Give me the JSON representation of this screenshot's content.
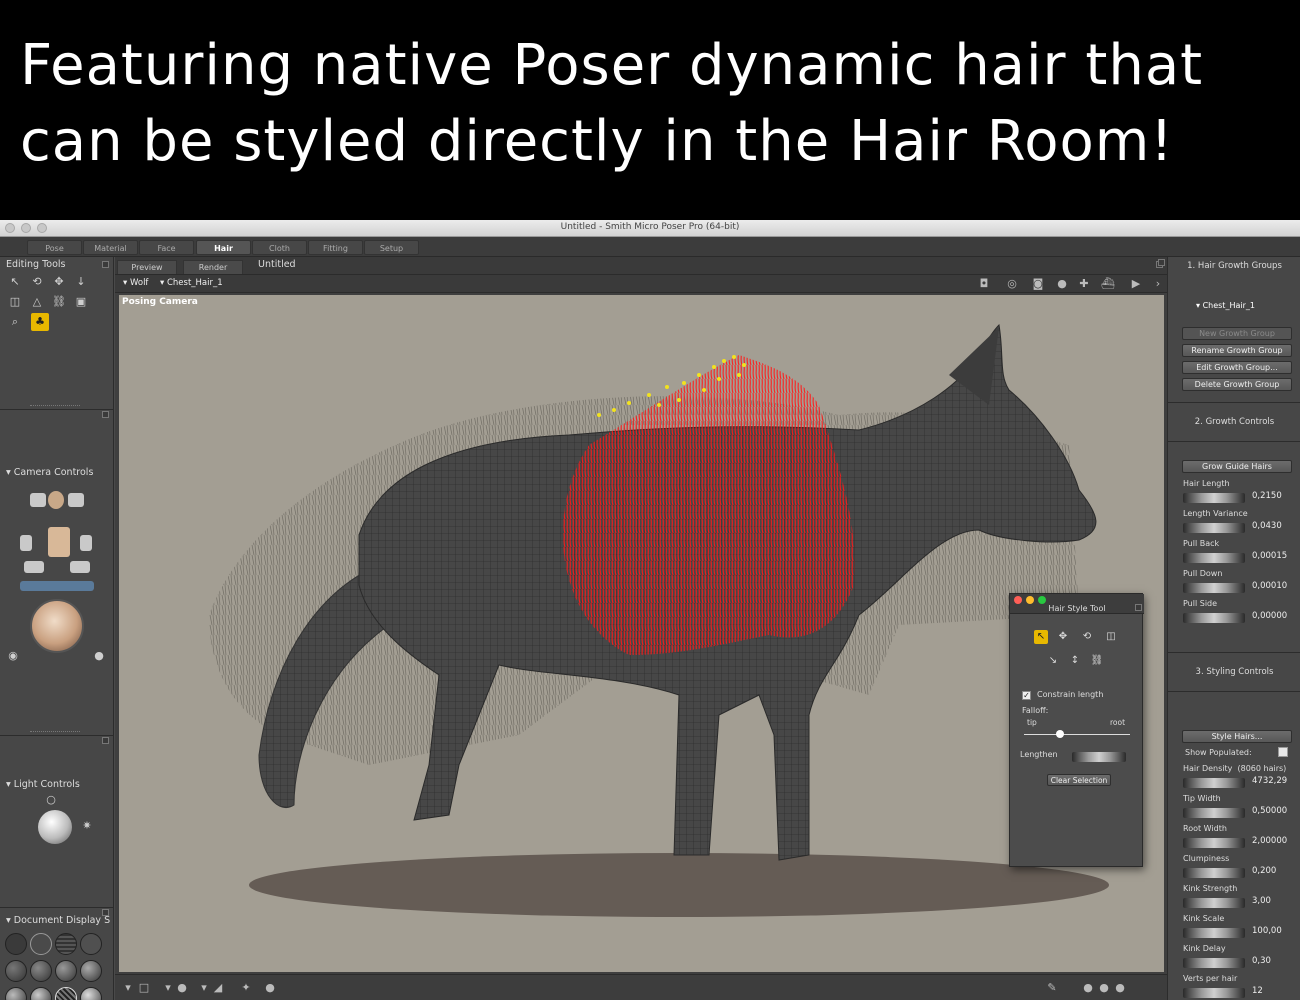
{
  "banner": {
    "line1": "Featuring native Poser dynamic hair that",
    "line2": "can be styled directly in the Hair Room!"
  },
  "window": {
    "title": "Untitled - Smith Micro Poser Pro  (64-bit)"
  },
  "room_tabs": [
    {
      "label": "Pose"
    },
    {
      "label": "Material"
    },
    {
      "label": "Face"
    },
    {
      "label": "Hair"
    },
    {
      "label": "Cloth"
    },
    {
      "label": "Fitting"
    },
    {
      "label": "Setup"
    }
  ],
  "active_room": "Hair",
  "left_panel": {
    "editing_tools": "Editing Tools",
    "camera_controls": "Camera Controls",
    "light_controls": "Light Controls",
    "document_display": "Document Display S"
  },
  "viewport": {
    "tabs": [
      {
        "label": "Preview"
      },
      {
        "label": "Render"
      }
    ],
    "document_name": "Untitled",
    "figure_select": "Wolf",
    "actor_select": "Chest_Hair_1",
    "camera_label": "Posing Camera"
  },
  "hair_style_tool": {
    "title": "Hair Style Tool",
    "constrain_length": "Constrain length",
    "constrain_checked": true,
    "falloff": "Falloff:",
    "tip": "tip",
    "root": "root",
    "lengthen": "Lengthen",
    "clear_selection": "Clear Selection"
  },
  "right_panel": {
    "section1": "1. Hair Growth Groups",
    "group_name": "Chest_Hair_1",
    "buttons": [
      {
        "label": "New Growth Group",
        "disabled": true
      },
      {
        "label": "Rename Growth Group",
        "disabled": false
      },
      {
        "label": "Edit Growth Group...",
        "disabled": false
      },
      {
        "label": "Delete Growth Group",
        "disabled": false
      }
    ],
    "section2": "2. Growth Controls",
    "grow_guide_hairs": "Grow Guide Hairs",
    "growth_params": [
      {
        "label": "Hair Length",
        "value": "0,2150"
      },
      {
        "label": "Length Variance",
        "value": "0,0430"
      },
      {
        "label": "Pull Back",
        "value": "0,00015"
      },
      {
        "label": "Pull Down",
        "value": "0,00010"
      },
      {
        "label": "Pull Side",
        "value": "0,00000"
      }
    ],
    "section3": "3. Styling Controls",
    "style_hairs": "Style Hairs...",
    "show_populated": "Show Populated:",
    "hair_density_label": "Hair Density",
    "hair_density_count": "(8060 hairs)",
    "hair_density_value": "4732,29",
    "styling_params": [
      {
        "label": "Tip Width",
        "value": "0,50000"
      },
      {
        "label": "Root Width",
        "value": "2,00000"
      },
      {
        "label": "Clumpiness",
        "value": "0,200"
      },
      {
        "label": "Kink Strength",
        "value": "3,00"
      },
      {
        "label": "Kink Scale",
        "value": "100,00"
      },
      {
        "label": "Kink Delay",
        "value": "0,30"
      },
      {
        "label": "Verts per hair",
        "value": "12"
      }
    ]
  },
  "colors": {
    "accent": "#e8b800",
    "viewport_bg": "#a39e93",
    "hair_selected": "#ff1a1a",
    "hair_guides_tip": "#f2e21e"
  }
}
